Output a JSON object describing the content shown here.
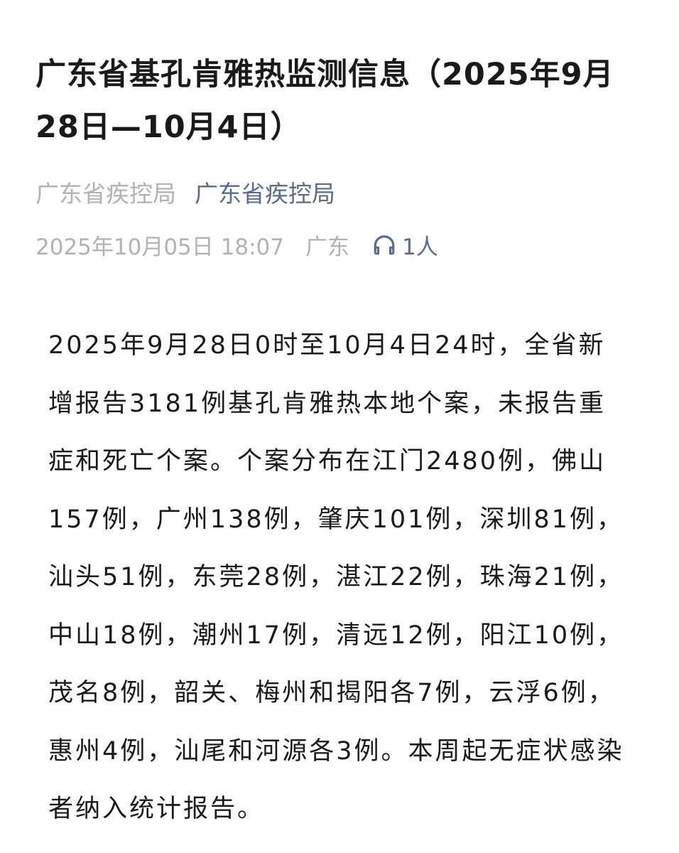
{
  "article": {
    "title": "广东省基孔肯雅热监测信息（2025年9月28日—10月4日）",
    "author": "广东省疾控局",
    "account_name": "广东省疾控局",
    "publish_time": "2025年10月05日 18:07",
    "location": "广东",
    "listen_count": "1人",
    "body": "2025年9月28日0时至10月4日24时，全省新增报告3181例基孔肯雅热本地个案，未报告重症和死亡个案。个案分布在江门2480例，佛山157例，广州138例，肇庆101例，深圳81例，汕头51例，东莞28例，湛江22例，珠海21例，中山18例，潮州17例，清远12例，阳江10例，茂名8例，韶关、梅州和揭阳各7例，云浮6例，惠州4例，汕尾和河源各3例。本周起无症状感染者纳入统计报告。"
  },
  "icons": {
    "listen": "headphones-icon"
  },
  "colors": {
    "title": "#1a1a1a",
    "meta_gray": "#b2b2b2",
    "link_blue": "#576b95",
    "body_text": "#1a1a1a",
    "background": "#ffffff"
  }
}
